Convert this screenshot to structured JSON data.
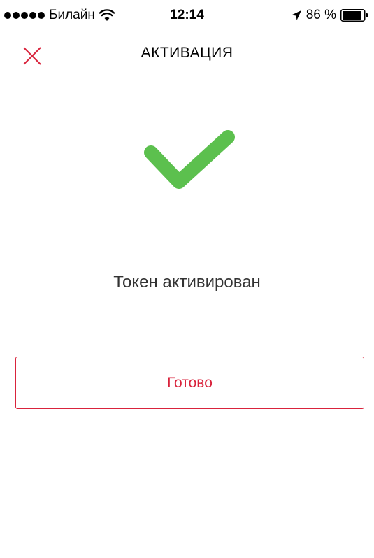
{
  "status_bar": {
    "carrier": "Билайн",
    "time": "12:14",
    "battery_percent": "86 %",
    "signal_icon": "signal-dots-icon",
    "wifi_icon": "wifi-icon",
    "location_icon": "location-arrow-icon",
    "battery_icon": "battery-icon"
  },
  "nav": {
    "title": "АКТИВАЦИЯ",
    "close_icon": "close-icon"
  },
  "content": {
    "success_icon": "checkmark-icon",
    "message": "Токен активирован",
    "done_label": "Готово"
  },
  "colors": {
    "accent": "#d9233c",
    "success": "#5cc04e",
    "divider": "#d0d0d0"
  }
}
